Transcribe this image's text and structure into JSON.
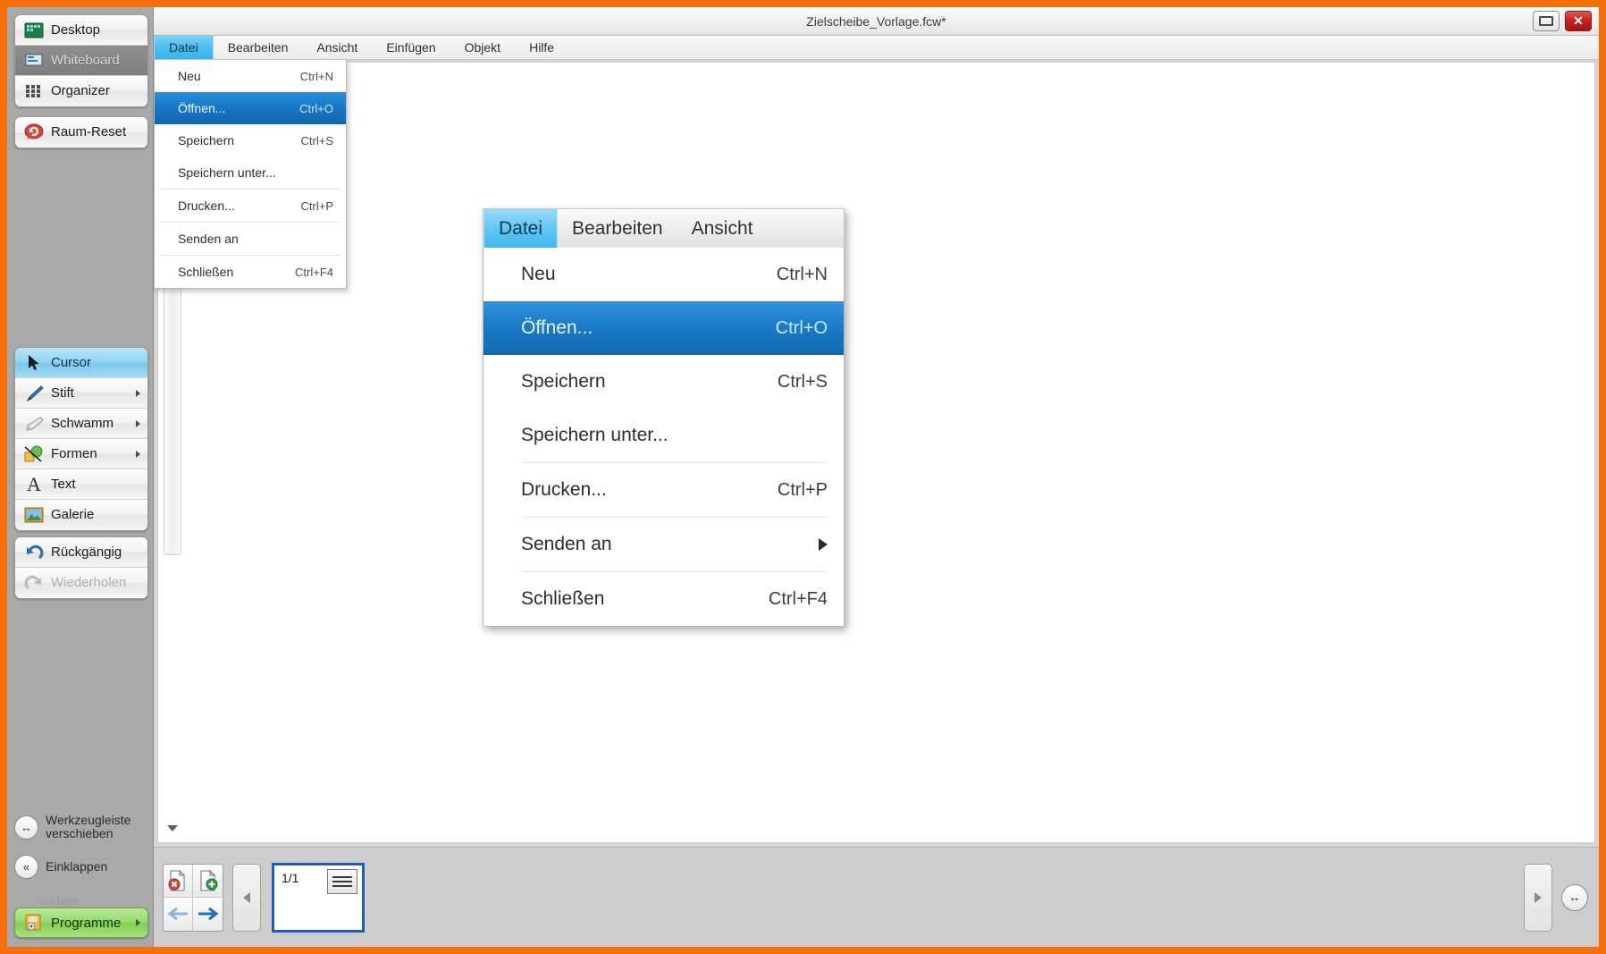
{
  "theme": {
    "frame_orange": "#f56f0c",
    "sidebar_gray": "#a9a9a9",
    "highlight_blue": "#1877c6",
    "menu_tab_cyan": "#49bdf0",
    "green_button": "#95da6d",
    "close_red": "#c32020",
    "page_border_blue": "#1b5fb5"
  },
  "window": {
    "title": "Zielscheibe_Vorlage.fcw*",
    "restore_label": "",
    "close_label": "✕"
  },
  "sidebar": {
    "top_items": [
      {
        "label": "Desktop",
        "icon": "desktop-icon",
        "state": "normal"
      },
      {
        "label": "Whiteboard",
        "icon": "whiteboard-icon",
        "state": "active"
      },
      {
        "label": "Organizer",
        "icon": "organizer-grid-icon",
        "state": "normal"
      }
    ],
    "reset_item": {
      "label": "Raum-Reset",
      "icon": "reset-speech-icon"
    },
    "tools": [
      {
        "label": "Cursor",
        "icon": "cursor-arrow-icon",
        "state": "selected",
        "submenu": false
      },
      {
        "label": "Stift",
        "icon": "pen-icon",
        "state": "normal",
        "submenu": true
      },
      {
        "label": "Schwamm",
        "icon": "eraser-icon",
        "state": "normal",
        "submenu": true
      },
      {
        "label": "Formen",
        "icon": "shapes-icon",
        "state": "normal",
        "submenu": true
      },
      {
        "label": "Text",
        "icon": "text-a-icon",
        "state": "normal",
        "submenu": false
      },
      {
        "label": "Galerie",
        "icon": "gallery-picture-icon",
        "state": "normal",
        "submenu": false
      }
    ],
    "history": [
      {
        "label": "Rückgängig",
        "icon": "undo-arrow-icon",
        "state": "normal"
      },
      {
        "label": "Wiederholen",
        "icon": "redo-arrow-icon",
        "state": "disabled"
      }
    ],
    "footer": [
      {
        "label_line1": "Werkzeugleiste",
        "label_line2": "verschieben",
        "icon": "move-horizontal-icon"
      },
      {
        "label_line1": "Einklappen",
        "label_line2": "",
        "icon": "collapse-double-left-icon"
      }
    ],
    "ghost_text": "vorlage",
    "programs_button": {
      "label": "Programme",
      "icon": "programs-icon"
    }
  },
  "menubar": {
    "items": [
      {
        "label": "Datei",
        "selected": true
      },
      {
        "label": "Bearbeiten",
        "selected": false
      },
      {
        "label": "Ansicht",
        "selected": false
      },
      {
        "label": "Einfügen",
        "selected": false
      },
      {
        "label": "Objekt",
        "selected": false
      },
      {
        "label": "Hilfe",
        "selected": false
      }
    ]
  },
  "file_menu": {
    "items": [
      {
        "label": "Neu",
        "accel": "Ctrl+N",
        "highlighted": false,
        "separator_after": false,
        "submenu": false
      },
      {
        "label": "Öffnen...",
        "accel": "Ctrl+O",
        "highlighted": true,
        "separator_after": false,
        "submenu": false
      },
      {
        "label": "Speichern",
        "accel": "Ctrl+S",
        "highlighted": false,
        "separator_after": false,
        "submenu": false
      },
      {
        "label": "Speichern unter...",
        "accel": "",
        "highlighted": false,
        "separator_after": true,
        "submenu": false
      },
      {
        "label": "Drucken...",
        "accel": "Ctrl+P",
        "highlighted": false,
        "separator_after": true,
        "submenu": false
      },
      {
        "label": "Senden an",
        "accel": "",
        "highlighted": false,
        "separator_after": true,
        "submenu": true
      },
      {
        "label": "Schließen",
        "accel": "Ctrl+F4",
        "highlighted": false,
        "separator_after": false,
        "submenu": false
      }
    ]
  },
  "zoom_overlay": {
    "menubar": [
      {
        "label": "Datei",
        "selected": true
      },
      {
        "label": "Bearbeiten",
        "selected": false
      },
      {
        "label": "Ansicht",
        "selected": false
      }
    ]
  },
  "bottombar": {
    "page_delete_label": "page-delete",
    "page_add_label": "page-add",
    "prev_label": "←",
    "next_label": "→",
    "scroll_left_label": "◀",
    "scroll_right_label": "▶",
    "page_indicator": "1/1",
    "resize_label": "↔"
  }
}
